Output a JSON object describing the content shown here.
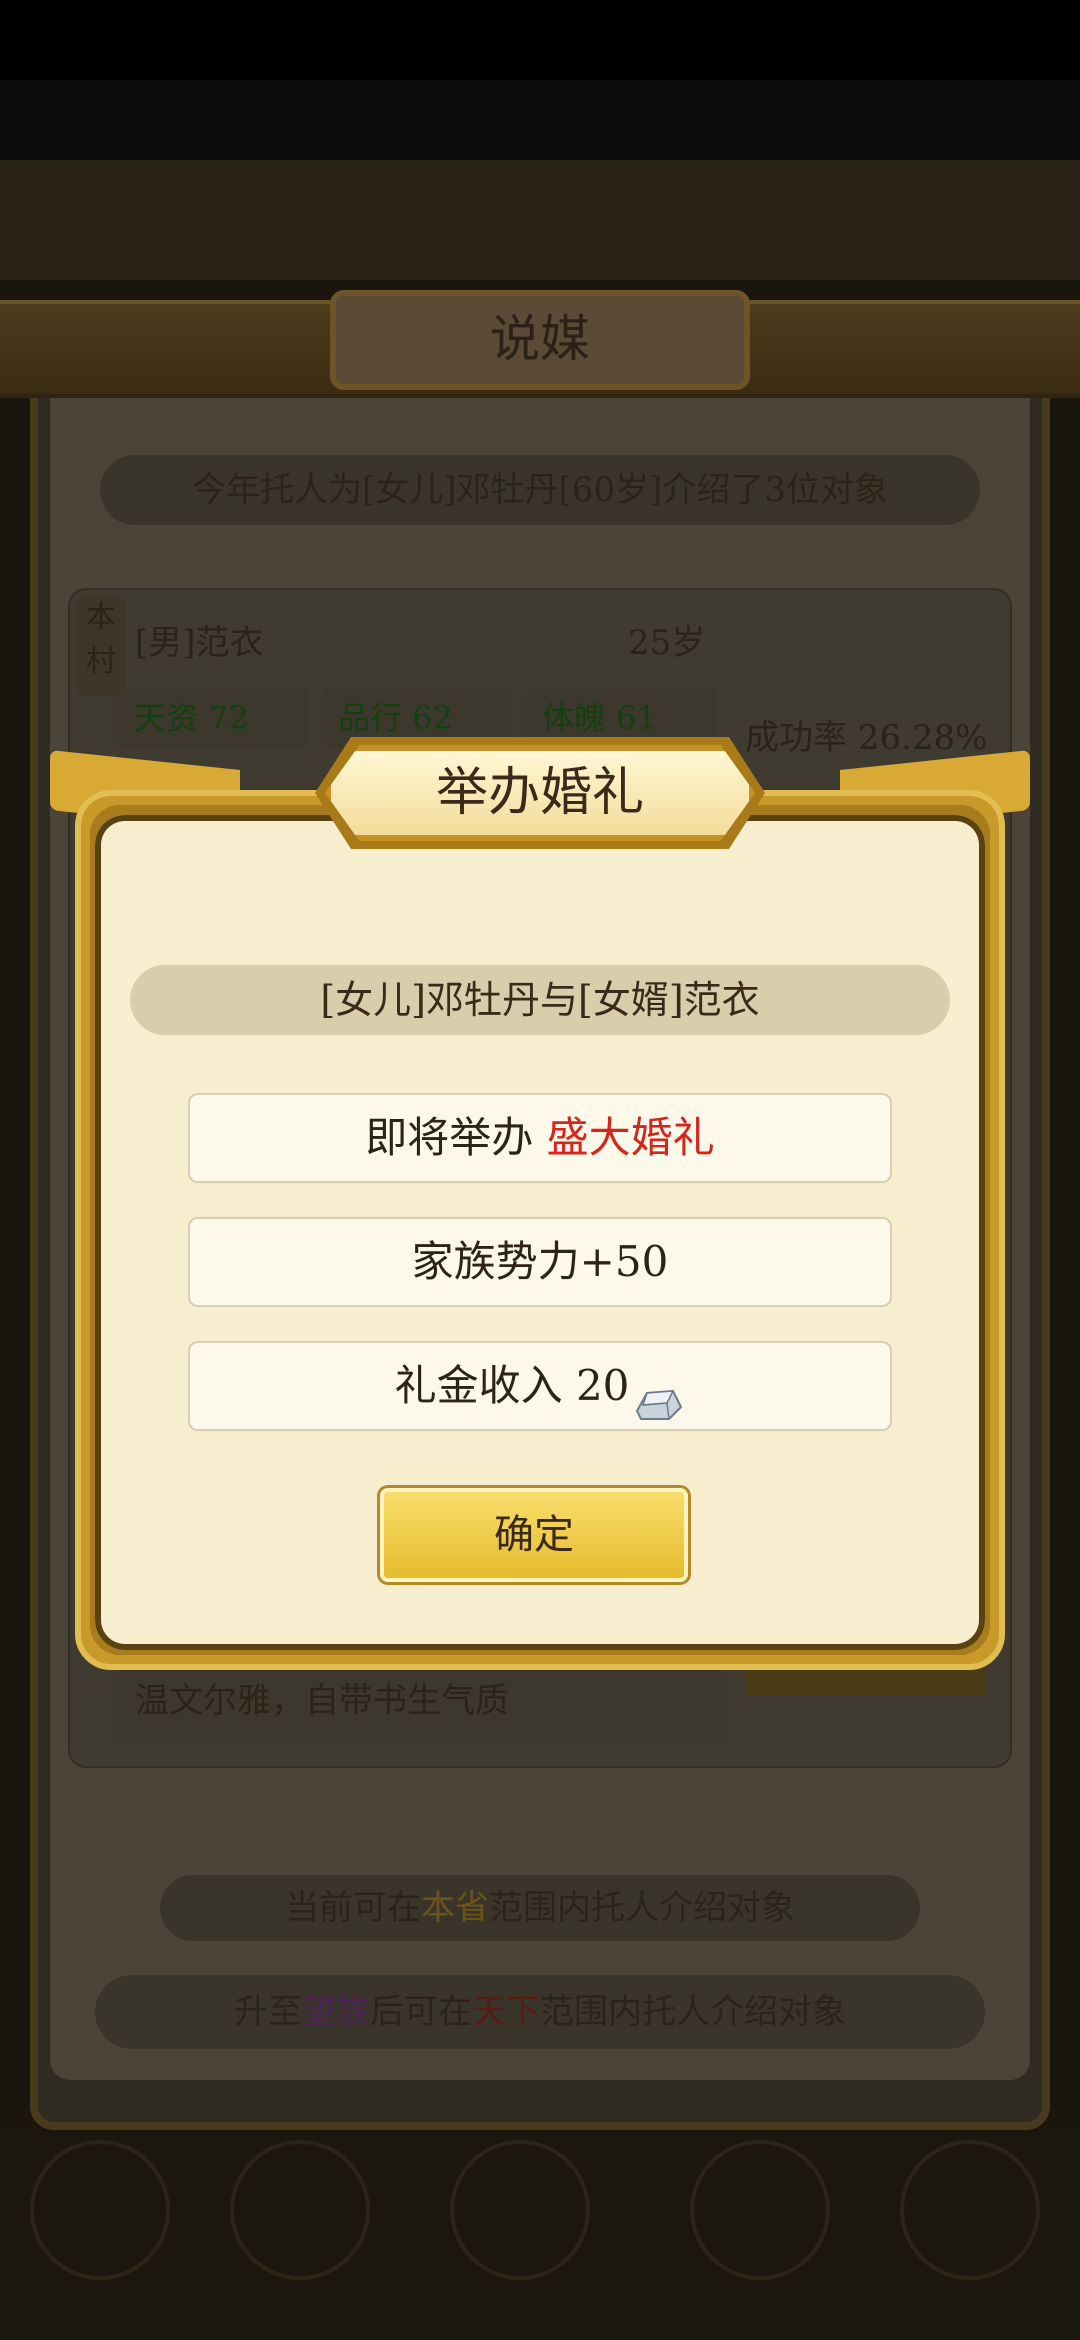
{
  "background": {
    "panel_title": "说媒",
    "intro": "今年托人为[女儿]邓牡丹[60岁]介绍了3位对象",
    "candidate": {
      "location_tag": "本村",
      "name": "[男]范衣",
      "age": "25岁",
      "stats": [
        "天资 72",
        "品行 62",
        "体魄 61"
      ],
      "success_rate": "成功率 26.28%",
      "description": "温文尔雅，自带书生气质"
    },
    "scope_line": {
      "prefix": "当前可在",
      "highlight": "本省",
      "suffix": "范围内托人介绍对象"
    },
    "upgrade_line": {
      "p1": "升至",
      "h1": "望族",
      "p2": "后可在",
      "h2": "天下",
      "p3": "范围内托人介绍对象"
    },
    "colors": {
      "stat_green": "#1f8a12",
      "gold": "#c99a1e",
      "purple": "#8a2fa0",
      "red": "#c0241a"
    }
  },
  "dialog": {
    "title": "举办婚礼",
    "couple": "[女儿]邓牡丹与[女婿]范衣",
    "wedding_prefix": "即将举办",
    "wedding_type": "盛大婚礼",
    "influence": "家族势力+50",
    "gift_money": "礼金收入 20",
    "gift_icon": "silver-ingot-icon",
    "confirm_label": "确定",
    "accent_color": "#d6261b"
  }
}
